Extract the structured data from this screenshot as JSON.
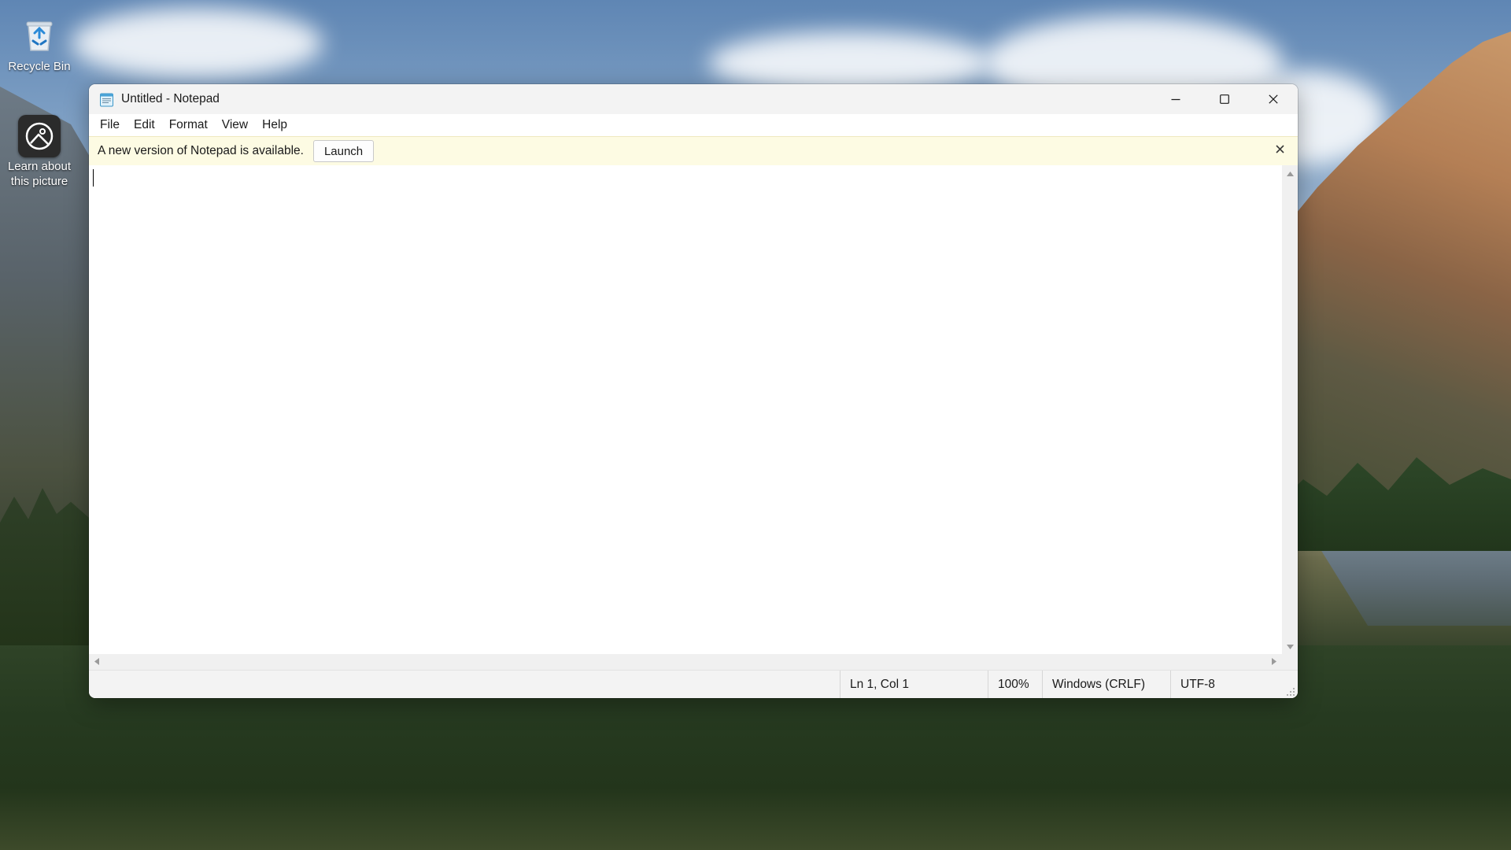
{
  "desktop": {
    "icons": [
      {
        "label": "Recycle Bin",
        "icon": "recycle-bin-icon"
      },
      {
        "label": "Learn about this picture",
        "icon": "learn-picture-icon"
      }
    ]
  },
  "window": {
    "title": "Untitled - Notepad",
    "app_icon": "notepad-icon",
    "controls": {
      "minimize": "minimize-icon",
      "maximize": "maximize-icon",
      "close": "close-icon"
    }
  },
  "menu": {
    "items": [
      "File",
      "Edit",
      "Format",
      "View",
      "Help"
    ]
  },
  "notification": {
    "message": "A new version of Notepad is available.",
    "action_label": "Launch",
    "dismiss_icon": "close-icon"
  },
  "editor": {
    "content": ""
  },
  "status": {
    "position": "Ln 1, Col 1",
    "zoom": "100%",
    "line_ending": "Windows (CRLF)",
    "encoding": "UTF-8"
  },
  "colors": {
    "infobar_bg": "#fdfbe3",
    "titlebar_bg": "#f3f3f3",
    "statusbar_bg": "#f3f3f3"
  }
}
